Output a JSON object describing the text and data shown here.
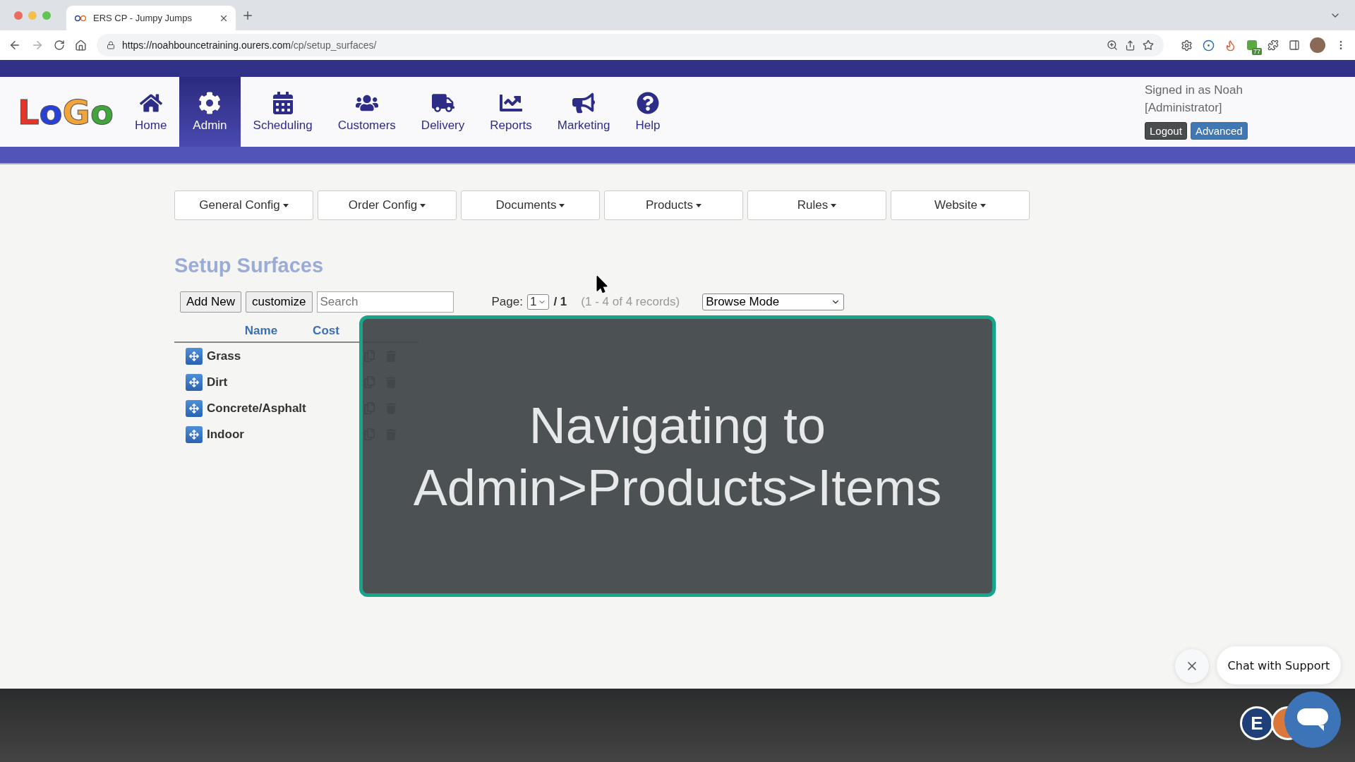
{
  "browser": {
    "tab_title": "ERS CP - Jumpy Jumps",
    "url_host": "https://noahbouncetraining.ourers.com",
    "url_path": "/cp/setup_surfaces/",
    "extension_badge": "77"
  },
  "logo": {
    "letters": [
      {
        "text": "L",
        "color": "#e5352b"
      },
      {
        "text": "o",
        "color": "#2640d8"
      },
      {
        "text": "G",
        "color": "#f2a33a"
      },
      {
        "text": "o",
        "color": "#3fa63a"
      }
    ]
  },
  "nav": {
    "items": [
      {
        "label": "Home",
        "selected": false
      },
      {
        "label": "Admin",
        "selected": true
      },
      {
        "label": "Scheduling",
        "selected": false
      },
      {
        "label": "Customers",
        "selected": false
      },
      {
        "label": "Delivery",
        "selected": false
      },
      {
        "label": "Reports",
        "selected": false
      },
      {
        "label": "Marketing",
        "selected": false
      },
      {
        "label": "Help",
        "selected": false
      }
    ]
  },
  "user": {
    "signed_in": "Signed in as Noah",
    "role": "[Administrator]",
    "buttons": [
      {
        "label": "Logout",
        "kind": "dark"
      },
      {
        "label": "Advanced",
        "kind": "primary"
      }
    ]
  },
  "config_menu": [
    "General Config",
    "Order Config",
    "Documents",
    "Products",
    "Rules",
    "Website"
  ],
  "page_title": "Setup Surfaces",
  "toolbar": {
    "buttons": [
      "Add New",
      "customize"
    ],
    "search": {
      "placeholder": "Search"
    },
    "page_label": "Page:",
    "page_value": "1",
    "page_total": "/ 1",
    "records": "(1 - 4 of 4 records)",
    "mode": "Browse Mode"
  },
  "table": {
    "columns": [
      "Name",
      "Cost"
    ],
    "rows": [
      {
        "name": "Grass"
      },
      {
        "name": "Dirt"
      },
      {
        "name": "Concrete/Asphalt"
      },
      {
        "name": "Indoor"
      }
    ]
  },
  "overlay": {
    "lines": [
      "Navigating to",
      "Admin>Products>Items"
    ]
  },
  "chat": {
    "label": "Chat with Support",
    "badge_letter": "E"
  }
}
